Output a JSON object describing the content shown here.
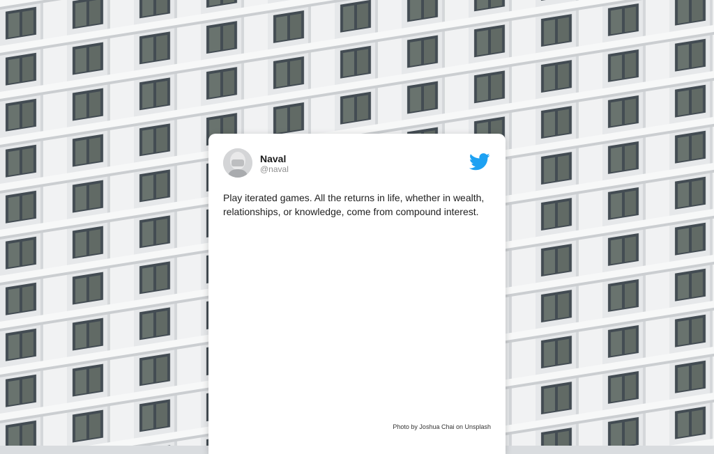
{
  "background": {
    "icon": "building-photo",
    "colors": {
      "facade": "#f2f3f4",
      "shade": "#c6c9cc",
      "window": "#1f2a33"
    }
  },
  "tweet": {
    "author_name": "Naval",
    "author_handle": "@naval",
    "avatar_icon": "author-avatar",
    "brand_icon": "twitter-bird-icon",
    "brand_color": "#1da1f2",
    "text": "Play iterated games. All the returns in life, whether in wealth, relationships, or knowledge, come from compound interest."
  },
  "photo_credit": "Photo by Joshua Chai on Unsplash"
}
